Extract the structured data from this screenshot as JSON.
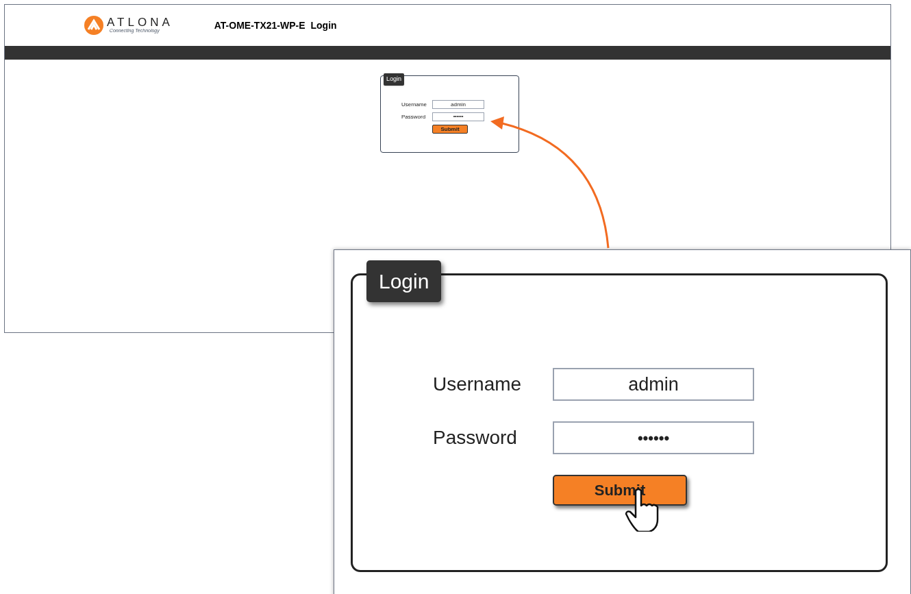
{
  "page": {
    "logo": {
      "wordmark": "ATLONA",
      "tagline": "Connecting Technology"
    },
    "model": "AT-OME-TX21-WP-E",
    "title": "Login"
  },
  "small_login": {
    "legend": "Login",
    "fields": [
      {
        "label": "Username",
        "value": "admin",
        "kind": "text"
      },
      {
        "label": "Password",
        "value": "••••••",
        "kind": "password"
      }
    ],
    "submit": "Submit"
  },
  "zoomed_login": {
    "legend": "Login",
    "fields": [
      {
        "label": "Username",
        "value": "admin",
        "kind": "text"
      },
      {
        "label": "Password",
        "value": "••••••",
        "kind": "password"
      }
    ],
    "submit": "Submit"
  }
}
